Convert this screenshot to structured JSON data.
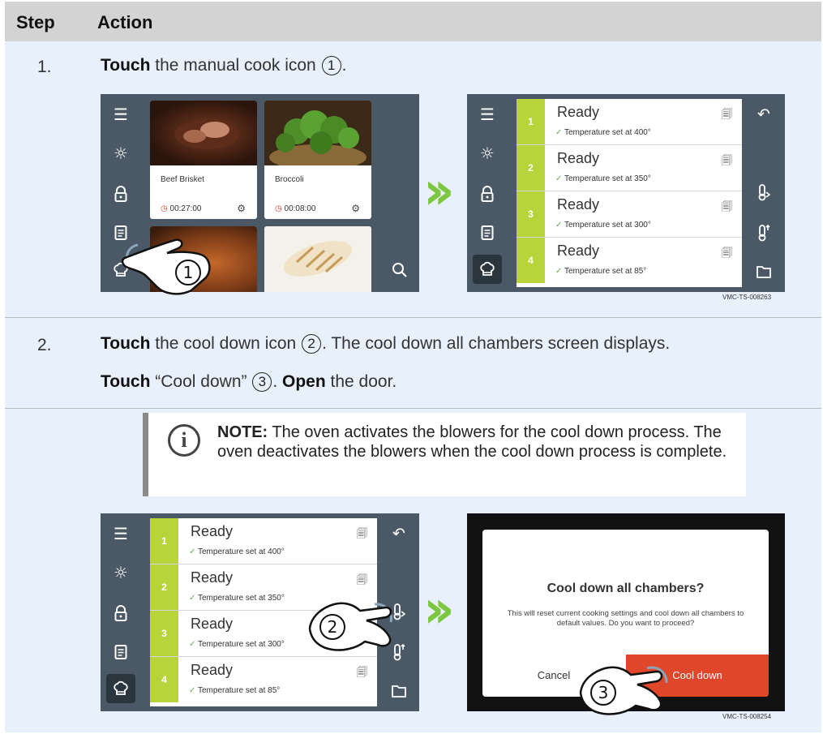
{
  "header": {
    "step": "Step",
    "action": "Action"
  },
  "step1": {
    "number": "1.",
    "verb": "Touch",
    "text": " the manual cook icon ",
    "callout": "1",
    "end": "."
  },
  "step2": {
    "number": "2.",
    "line1_verb": "Touch",
    "line1_text": " the cool down icon ",
    "line1_callout": "2",
    "line1_end": ". The cool down all chambers screen displays.",
    "line2_verb": "Touch",
    "line2_text": " “Cool down” ",
    "line2_callout": "3",
    "line2_mid": ". ",
    "line2_verb2": "Open",
    "line2_end": " the door."
  },
  "note": {
    "label": "NOTE:",
    "text": " The oven activates the blowers for the cool down process. The oven deactivates the blowers when the cool down process is complete."
  },
  "recipes": [
    {
      "name": "Beef Brisket",
      "time": "00:27:00"
    },
    {
      "name": "Broccoli",
      "time": "00:08:00"
    }
  ],
  "chambers": [
    {
      "num": "1",
      "status": "Ready",
      "temp": "Temperature set at 400°"
    },
    {
      "num": "2",
      "status": "Ready",
      "temp": "Temperature set at 350°"
    },
    {
      "num": "3",
      "status": "Ready",
      "temp": "Temperature set at 300°"
    },
    {
      "num": "4",
      "status": "Ready",
      "temp": "Temperature set at 85°"
    }
  ],
  "dialog": {
    "title": "Cool down all chambers?",
    "message": "This will reset current cooking settings and cool down all chambers to default values. Do you want to proceed?",
    "cancel": "Cancel",
    "confirm": "Cool down"
  },
  "figure_ids": [
    "VMC-TS-008263",
    "VMC-TS-008254"
  ],
  "callouts": [
    "1",
    "2",
    "3"
  ],
  "colors": {
    "accent_green": "#b8d43a",
    "arrow_green": "#7dc63f",
    "danger": "#e0472a",
    "panel": "#4b5966"
  },
  "icons": [
    "menu-icon",
    "brightness-icon",
    "lock-icon",
    "recipe-book-icon",
    "chef-hat-icon",
    "search-icon",
    "back-icon",
    "cool-down-icon",
    "preheat-icon",
    "folder-icon",
    "info-icon"
  ]
}
